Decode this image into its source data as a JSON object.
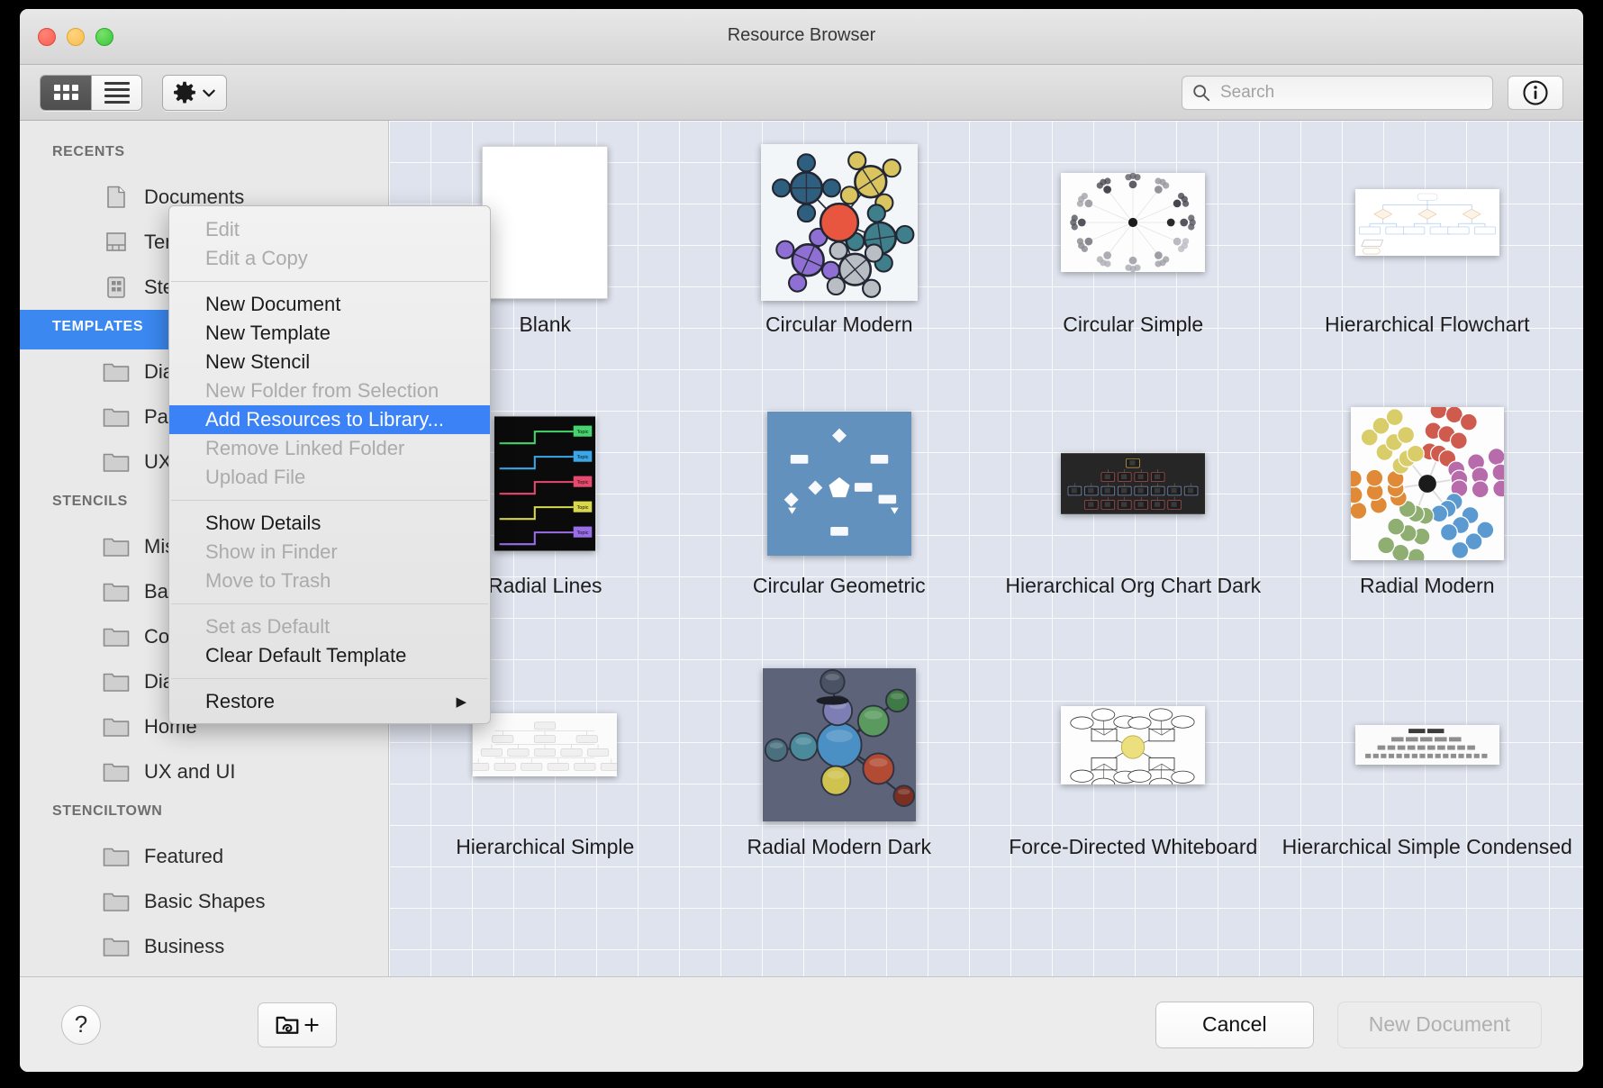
{
  "window": {
    "title": "Resource Browser"
  },
  "toolbar": {
    "grid_view": "grid-view",
    "list_view": "list-view",
    "gear_label": "action-menu",
    "search_placeholder": "Search",
    "search_value": "",
    "info_label": "info"
  },
  "menu": {
    "groups": [
      [
        {
          "label": "Edit",
          "state": "disabled"
        },
        {
          "label": "Edit a Copy",
          "state": "disabled"
        }
      ],
      [
        {
          "label": "New Document",
          "state": "enabled"
        },
        {
          "label": "New Template",
          "state": "enabled"
        },
        {
          "label": "New Stencil",
          "state": "enabled"
        },
        {
          "label": "New Folder from Selection",
          "state": "disabled"
        },
        {
          "label": "Add Resources to Library...",
          "state": "highlight"
        },
        {
          "label": "Remove Linked Folder",
          "state": "disabled"
        },
        {
          "label": "Upload File",
          "state": "disabled"
        }
      ],
      [
        {
          "label": "Show Details",
          "state": "enabled"
        },
        {
          "label": "Show in Finder",
          "state": "disabled"
        },
        {
          "label": "Move to Trash",
          "state": "disabled"
        }
      ],
      [
        {
          "label": "Set as Default",
          "state": "disabled"
        },
        {
          "label": "Clear Default Template",
          "state": "enabled"
        }
      ],
      [
        {
          "label": "Restore",
          "state": "enabled",
          "submenu": "▶"
        }
      ]
    ]
  },
  "sidebar": {
    "sections": [
      {
        "header": "RECENTS",
        "selected": false,
        "items": [
          {
            "label": "Documents",
            "icon": "document-icon"
          },
          {
            "label": "Templates",
            "icon": "template-icon"
          },
          {
            "label": "Stencils",
            "icon": "stencil-icon"
          }
        ]
      },
      {
        "header": "TEMPLATES",
        "selected": true,
        "items": [
          {
            "label": "Diagrams",
            "icon": "folder-icon"
          },
          {
            "label": "Paper",
            "icon": "folder-icon"
          },
          {
            "label": "UX and UI",
            "icon": "folder-icon"
          }
        ]
      },
      {
        "header": "STENCILS",
        "selected": false,
        "items": [
          {
            "label": "Miscellaneous",
            "icon": "folder-icon"
          },
          {
            "label": "Basic Shapes",
            "icon": "folder-icon"
          },
          {
            "label": "Colors",
            "icon": "folder-icon"
          },
          {
            "label": "Diagrams",
            "icon": "folder-icon"
          },
          {
            "label": "Home",
            "icon": "folder-icon"
          },
          {
            "label": "UX and UI",
            "icon": "folder-icon"
          }
        ]
      },
      {
        "header": "STENCILTOWN",
        "selected": false,
        "items": [
          {
            "label": "Featured",
            "icon": "folder-icon"
          },
          {
            "label": "Basic Shapes",
            "icon": "folder-icon"
          },
          {
            "label": "Business",
            "icon": "folder-icon"
          }
        ]
      }
    ]
  },
  "content": {
    "items": [
      {
        "label": "Blank",
        "thumb": "blank"
      },
      {
        "label": "Circular Modern",
        "thumb": "circular-modern"
      },
      {
        "label": "Circular Simple",
        "thumb": "circular-simple"
      },
      {
        "label": "Hierarchical Flowchart",
        "thumb": "hierarchical-flowchart"
      },
      {
        "label": "Radial Lines",
        "thumb": "radial-lines"
      },
      {
        "label": "Circular Geometric",
        "thumb": "circular-geometric"
      },
      {
        "label": "Hierarchical Org Chart Dark",
        "thumb": "hierarchical-org-chart-dark"
      },
      {
        "label": "Radial Modern",
        "thumb": "radial-modern"
      },
      {
        "label": "Hierarchical Simple",
        "thumb": "hierarchical-simple"
      },
      {
        "label": "Radial Modern Dark",
        "thumb": "radial-modern-dark"
      },
      {
        "label": "Force-Directed Whiteboard",
        "thumb": "force-directed-whiteboard"
      },
      {
        "label": "Hierarchical Simple Condensed",
        "thumb": "hierarchical-simple-condensed"
      }
    ]
  },
  "footer": {
    "help_label": "?",
    "add_folder_label": "add-linked-folder",
    "cancel_label": "Cancel",
    "new_document_label": "New Document"
  },
  "colors": {
    "accent": "#3b82f6",
    "sidebar_bg": "#e9e9e9",
    "canvas_bg": "#dfe3ee"
  }
}
